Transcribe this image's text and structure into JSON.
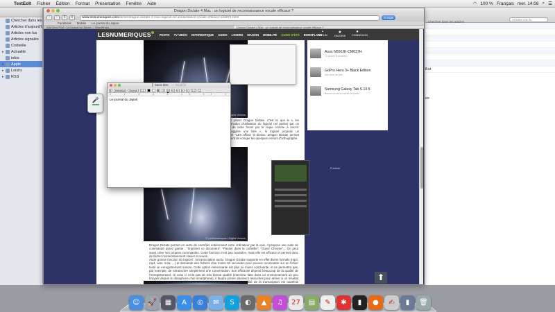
{
  "menubar": {
    "app_name": "TextEdit",
    "menus": [
      "Fichier",
      "Édition",
      "Format",
      "Présentation",
      "Fenêtre",
      "Aide"
    ],
    "status": {
      "battery": "100 %",
      "language": "Français",
      "clock": "mer. 14:08"
    }
  },
  "left_app": {
    "sidebar": [
      {
        "label": "Chercher dans les résu",
        "selected": false,
        "expandable": false
      },
      {
        "label": "Articles d'aujourd'hui",
        "selected": false,
        "expandable": false
      },
      {
        "label": "Articles non lus",
        "selected": false,
        "expandable": false
      },
      {
        "label": "Articles signalés",
        "selected": false,
        "expandable": false
      },
      {
        "label": "Corbeille",
        "selected": false,
        "expandable": false
      },
      {
        "label": "Actualité",
        "selected": false,
        "expandable": true
      },
      {
        "label": "infos",
        "selected": false,
        "expandable": false
      },
      {
        "label": "Apple",
        "selected": true,
        "expandable": true
      },
      {
        "label": "Loisirs",
        "selected": false,
        "expandable": true
      },
      {
        "label": "RSS",
        "selected": false,
        "expandable": true
      }
    ]
  },
  "right_app": {
    "search_hint": "Chercher dans les articles",
    "search_value": "Articles non lu",
    "fragments": [
      "Bat",
      "es"
    ]
  },
  "safari": {
    "window_title": "Dragon Dictate 4 Mac : un logiciel de reconnaissance vocale efficace ?",
    "url_domain": "www.lesnumeriques.com",
    "url_path": "/dicter/dragon-dictate-4-mac-logiciel-reconnaissance-vocale-efficace-n33074.html",
    "search_button": "Google",
    "bookmarks": [
      "Facebook",
      "Mobile",
      "Le journal du Japon"
    ],
    "tabs": [
      "Add New Post ‹ Le journal du Japon — WordPress",
      "Dragon Dictate 4 Mac : un logiciel de reconnaissance vocale efficace ?"
    ]
  },
  "site": {
    "logo": "LESNUMERIQUES",
    "nav": [
      "PHOTO",
      "TV VIDÉO",
      "INFORMATIQUE",
      "AUDIO",
      "LOISIRS",
      "MAISON",
      "MOBILITÉ",
      "GUIDE D'ÉTÉ",
      "BONSPLANS"
    ],
    "nav_highlight": "GUIDE D'ÉTÉ",
    "header_icons": [
      {
        "label": "FORUM",
        "icon": "chat-icon"
      },
      {
        "label": "FAVORIS",
        "icon": "star-icon"
      },
      {
        "label": "CONNEXION",
        "icon": "user-icon"
      }
    ],
    "photo_credit": "© LesNumeriques | Digital Version",
    "snippet": "de » pour piloter Dragon Dictate. C'est ici que le s, les différents modes d'utilisation du logiciel uel passer par un traitement de texte fourni par le nique comme à microl. Dragon suggère une liste », le logiciel propose un complément \"LES affiner la diction, Dragon Dictate permet d'énoncer ent de corriger les quelques erreurs d'orthographe.",
    "para1": "Dragon Dictate permet en outre de contrôler entièrement votre ordinateur par la voix. Il propose une suite de commande assez garnie : \"Imprimer ce document\", \"Passer dans la corbeille\", \"Ouvrir Chrome\"... On peut aussi créer ses propres commandes. Cette fonction n'est pas novatrice, mais elle est efficace et permet donc de lâcher momentanément clavier et souris.",
    "para2": "Autre grosse fonction du logiciel : la transcription audio. Dragon Dictate supporte en effet divers formats (mp3, mp4, wav, m4a, ...) et demande des fichiers d'au moins 60 secondes pour pouvoir reconnaitre sur un fichier texte un enregistrement sonore. Cette option intéressante est plus ou moins concluante, et ne permettra pas, par exemple, de retranscrire simplement une conversation. Son efficacité dépend beaucoup de la qualité de l'enregistrement. Si celui ci n'est pas de très bonne qualité (interview faite dans un environnement un peu bruyant depuis le dictaphone d'un smartphone), il faudra primer plusieurs retouches pour arriver à un résultat concluant, et ajouter ultérieurement au clavier la ponctuation. La qualité de la transcription est toutefois supérieure quand on sourcé à Dragon Dictate notre propre voix.",
    "products": [
      {
        "name": "Asus N550JK-CM037H",
        "sub": "Le pouce d'occasion"
      },
      {
        "name": "GoPro Hero 3+ Black Edition",
        "sub": "Voir plus de prix"
      },
      {
        "name": "Samsung Galaxy Tab S 10.5",
        "sub": "Bonne occasion achat de poids"
      }
    ],
    "ad_label": "Publicité"
  },
  "textedit": {
    "title": "Sans titre",
    "modified": "— Modifié",
    "font_family": "Helvetica",
    "font_style": "Normal",
    "font_size": "12",
    "spacing": "1.0",
    "ruler": "0 2 4 6 8 10 12 14 16 18",
    "content": "Le journal du Japon"
  },
  "dock": {
    "apps": [
      {
        "icon": "finder-icon",
        "glyph": "☺",
        "color": "#4a8fe0"
      },
      {
        "icon": "launchpad-icon",
        "glyph": "🚀",
        "color": "#9aa3ad"
      },
      {
        "icon": "mission-control-icon",
        "glyph": "▦",
        "color": "#556"
      },
      {
        "icon": "app-store-icon",
        "glyph": "A",
        "color": "#3c8fe6"
      },
      {
        "icon": "safari-icon",
        "glyph": "◎",
        "color": "#3a7fd6"
      },
      {
        "icon": "mail-icon",
        "glyph": "✉",
        "color": "#7bb0e6"
      },
      {
        "icon": "skype-icon",
        "glyph": "S",
        "color": "#13a0e0"
      },
      {
        "icon": "photo-icon",
        "glyph": "◐",
        "color": "#6a6a6a"
      },
      {
        "icon": "vlc-icon",
        "glyph": "▲",
        "color": "#e8822a"
      },
      {
        "icon": "itunes-icon",
        "glyph": "♫",
        "color": "#c24dd6"
      },
      {
        "icon": "calendar-icon",
        "glyph": "27",
        "color": "#e9e9e9"
      },
      {
        "icon": "preview-icon",
        "glyph": "▤",
        "color": "#8a6"
      },
      {
        "icon": "textedit-icon",
        "glyph": "✎",
        "color": "#eee"
      },
      {
        "icon": "reeder-icon",
        "glyph": "✱",
        "color": "#d33"
      },
      {
        "icon": "terminal-icon",
        "glyph": "▮",
        "color": "#222"
      },
      {
        "icon": "firefox-icon",
        "glyph": "●",
        "color": "#e66a18"
      },
      {
        "icon": "script-editor-icon",
        "glyph": "✍",
        "color": "#ccc"
      },
      {
        "icon": "downloads-icon",
        "glyph": "▮",
        "color": "#6b7a99"
      },
      {
        "icon": "trash-icon",
        "glyph": "🗑",
        "color": "#9aa"
      }
    ]
  }
}
